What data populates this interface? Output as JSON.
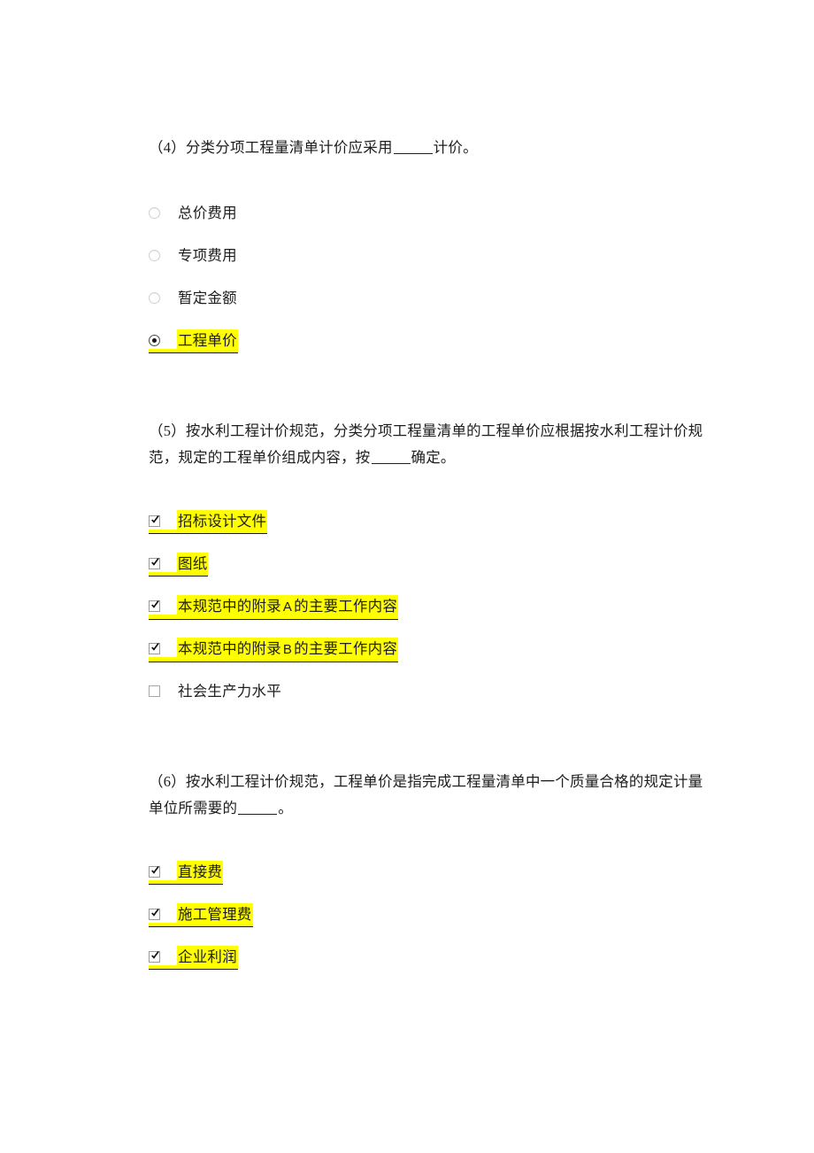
{
  "document": {
    "page_background": "#ffffff",
    "highlight_color": "#ffff00",
    "text_color": "#1d1d1d",
    "questions": [
      {
        "id": "q4",
        "number": "（4）",
        "text_before_blank": "分类分项工程量清单计价应采用",
        "text_after_blank": "计价。",
        "full_text": "（4）分类分项工程量清单计价应采用______计价。",
        "input_type": "radio",
        "options": [
          {
            "label": "总价费用",
            "checked": false,
            "highlighted": false
          },
          {
            "label": "专项费用",
            "checked": false,
            "highlighted": false
          },
          {
            "label": "暂定金额",
            "checked": false,
            "highlighted": false
          },
          {
            "label": "工程单价",
            "checked": true,
            "highlighted": true
          }
        ]
      },
      {
        "id": "q5",
        "number": "（5）",
        "text_line_1_before_blank": "按水利工程计价规范，分类分项工程量清单的工程单价应根据按水利工",
        "text_line_2_before_blank": "程计价规范，规定的工程单价组成内容，按",
        "text_after_blank": "确定。",
        "full_text": "（5）按水利工程计价规范，分类分项工程量清单的工程单价应根据按水利工程计价规范，规定的工程单价组成内容，按______确定。",
        "input_type": "checkbox",
        "options": [
          {
            "label": "招标设计文件",
            "checked": true,
            "highlighted": true
          },
          {
            "label": "图纸",
            "checked": true,
            "highlighted": true
          },
          {
            "label_pre": "本规范中的附录",
            "label_latin": "A",
            "label_post": "的主要工作内容",
            "label": "本规范中的附录 A 的主要工作内容",
            "checked": true,
            "highlighted": true
          },
          {
            "label_pre": "本规范中的附录",
            "label_latin": "B",
            "label_post": "的主要工作内容",
            "label": "本规范中的附录 B 的主要工作内容",
            "checked": true,
            "highlighted": true
          },
          {
            "label": "社会生产力水平",
            "checked": false,
            "highlighted": false
          }
        ]
      },
      {
        "id": "q6",
        "number": "（6）",
        "text_line_1_before_blank": "按水利工程计价规范，工程单价是指完成工程量清单中一个质量合格的",
        "text_line_2_before_blank": "规定计量单位所需要的",
        "text_after_blank": "。",
        "full_text": "（6）按水利工程计价规范，工程单价是指完成工程量清单中一个质量合格的规定计量单位所需要的______。",
        "input_type": "checkbox",
        "options": [
          {
            "label": "直接费",
            "checked": true,
            "highlighted": true
          },
          {
            "label": "施工管理费",
            "checked": true,
            "highlighted": true
          },
          {
            "label": "企业利润",
            "checked": true,
            "highlighted": true
          }
        ]
      }
    ]
  }
}
